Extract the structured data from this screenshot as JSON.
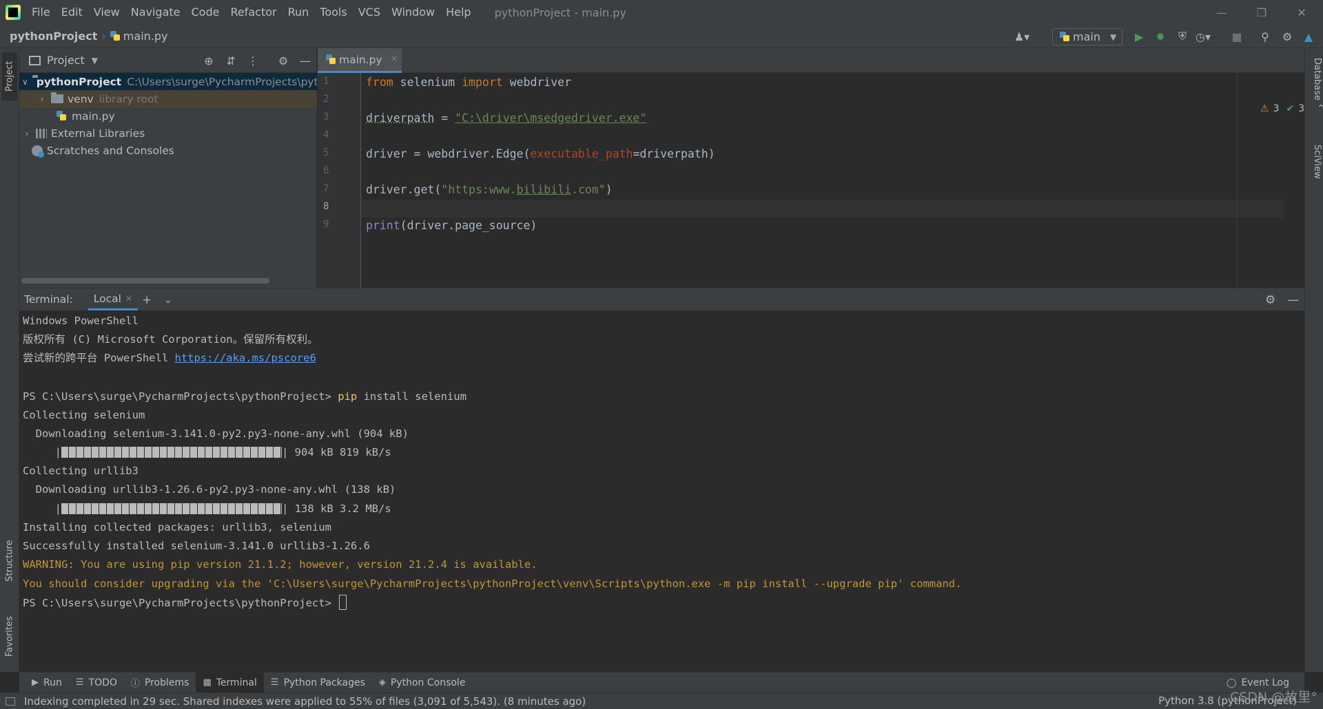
{
  "app": {
    "window_title": "pythonProject - main.py"
  },
  "menu": [
    "File",
    "Edit",
    "View",
    "Navigate",
    "Code",
    "Refactor",
    "Run",
    "Tools",
    "VCS",
    "Window",
    "Help"
  ],
  "breadcrumb": {
    "project": "pythonProject",
    "file": "main.py"
  },
  "run_config": {
    "label": "main"
  },
  "left_tabs": {
    "project": "Project",
    "structure": "Structure",
    "favorites": "Favorites"
  },
  "right_tabs": {
    "database": "Database",
    "sciview": "SciView"
  },
  "project_panel": {
    "title": "Project",
    "tree": {
      "root_name": "pythonProject",
      "root_path": "C:\\Users\\surge\\PycharmProjects\\pythonProject",
      "venv": "venv",
      "venv_hint": "library root",
      "main": "main.py",
      "ext_libs": "External Libraries",
      "scratches": "Scratches and Consoles"
    }
  },
  "editor": {
    "tab": "main.py",
    "line_numbers": [
      "1",
      "2",
      "3",
      "4",
      "5",
      "6",
      "7",
      "8",
      "9"
    ],
    "code": {
      "l1_kw1": "from",
      "l1_a": " selenium ",
      "l1_kw2": "import",
      "l1_b": " webdriver",
      "l3_var": "driverpath",
      "l3_eq": " = ",
      "l3_str": "\"C:\\driver\\msedgedriver.exe\"",
      "l5_a": "driver = webdriver.Edge(",
      "l5_param": "executable_path",
      "l5_b": "=driverpath)",
      "l7_a": "driver.get(",
      "l7_s1": "\"https:www.",
      "l7_s2": "bilibili",
      "l7_s3": ".com\"",
      "l7_b": ")",
      "l9_fn": "print",
      "l9_a": "(driver.page_source)"
    },
    "inspections": {
      "warnings": "3",
      "weak_warnings": "3"
    }
  },
  "terminal": {
    "title": "Terminal:",
    "tab": "Local",
    "lines": {
      "l1": "Windows PowerShell",
      "l2": "版权所有 (C) Microsoft Corporation。保留所有权利。",
      "l3_text": "尝试新的跨平台 PowerShell ",
      "l3_link": "https://aka.ms/pscore6",
      "l4_prompt": "PS C:\\Users\\surge\\PycharmProjects\\pythonProject> ",
      "l4_cmd": "pip",
      "l4_rest": " install selenium",
      "l5": "Collecting selenium",
      "l6": "  Downloading selenium-3.141.0-py2.py3-none-any.whl (904 kB)",
      "l7_pre": "     |",
      "l7_post": "| 904 kB 819 kB/s",
      "l8": "Collecting urllib3",
      "l9": "  Downloading urllib3-1.26.6-py2.py3-none-any.whl (138 kB)",
      "l10_pre": "     |",
      "l10_post": "| 138 kB 3.2 MB/s",
      "l11": "Installing collected packages: urllib3, selenium",
      "l12": "Successfully installed selenium-3.141.0 urllib3-1.26.6",
      "l13": "WARNING: You are using pip version 21.1.2; however, version 21.2.4 is available.",
      "l14": "You should consider upgrading via the 'C:\\Users\\surge\\PycharmProjects\\pythonProject\\venv\\Scripts\\python.exe -m pip install --upgrade pip' command.",
      "l15_prompt": "PS C:\\Users\\surge\\PycharmProjects\\pythonProject> "
    }
  },
  "bottom_tools": {
    "run": "Run",
    "todo": "TODO",
    "problems": "Problems",
    "terminal": "Terminal",
    "python_packages": "Python Packages",
    "python_console": "Python Console",
    "event_log": "Event Log"
  },
  "status": {
    "message": "Indexing completed in 29 sec. Shared indexes were applied to 55% of files (3,091 of 5,543). (8 minutes ago)",
    "interpreter": "Python 3.8 (pythonProject)",
    "watermark": "CSDN @故里°"
  },
  "colors": {
    "accent": "#4a88c7",
    "run_green": "#499c54",
    "warning": "#c39536"
  }
}
